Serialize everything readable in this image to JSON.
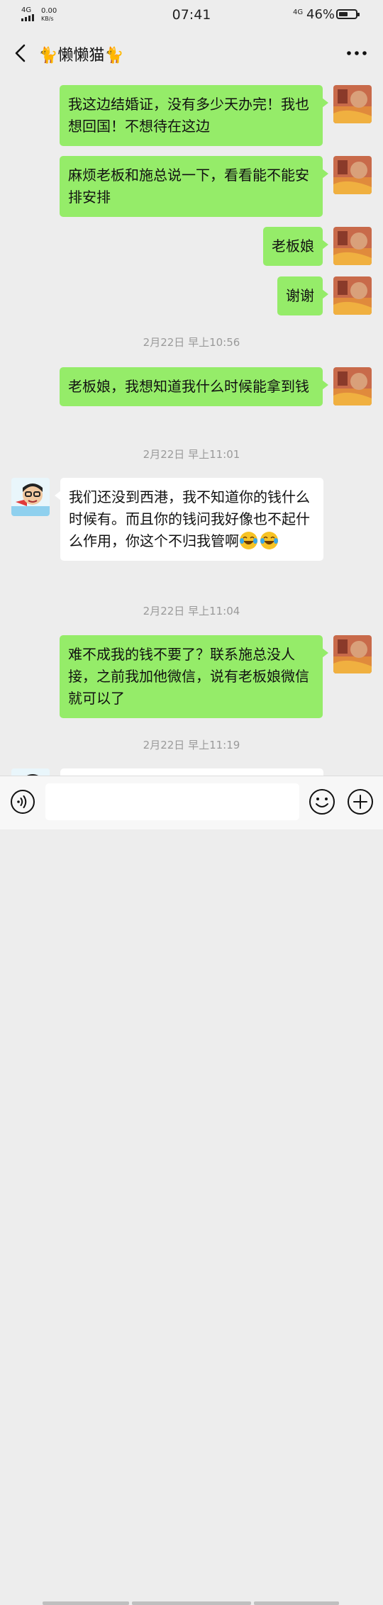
{
  "status_bar": {
    "network": "4G",
    "speed_value": "0.00",
    "speed_unit": "KB/s",
    "time": "07:41",
    "right_network": "4G",
    "battery": "46%"
  },
  "header": {
    "title": "🐈懒懒猫🐈"
  },
  "messages": [
    {
      "from": "me",
      "text": "我这边结婚证，没有多少天办完！我也想回国！不想待在这边"
    },
    {
      "from": "me",
      "text": "麻烦老板和施总说一下，看看能不能安排安排"
    },
    {
      "from": "me",
      "text": "老板娘"
    },
    {
      "from": "me",
      "text": "谢谢"
    },
    {
      "type": "time",
      "text": "2月22日 早上10:56"
    },
    {
      "from": "me",
      "text": "老板娘，我想知道我什么时候能拿到钱"
    },
    {
      "type": "time",
      "text": "2月22日 早上11:01"
    },
    {
      "from": "them",
      "text": "我们还没到西港，我不知道你的钱什么时候有。而且你的钱问我好像也不起什么作用，你这个不归我管啊"
    },
    {
      "type": "time",
      "text": "2月22日 早上11:04"
    },
    {
      "from": "me",
      "text": "难不成我的钱不要了？联系施总没人接，之前我加他微信，说有老板娘微信就可以了"
    },
    {
      "type": "time",
      "text": "2月22日 早上11:19"
    }
  ],
  "input": {
    "value": "",
    "placeholder": ""
  },
  "icons": {
    "back": "chevron-left-icon",
    "more": "more-dots-icon",
    "voice": "voice-icon",
    "emoji": "smiley-icon",
    "plus": "plus-circle-icon",
    "laugh_cry": "laughing-crying-emoji-icon"
  },
  "colors": {
    "background": "#ededed",
    "my_bubble": "#95ec69",
    "their_bubble": "#ffffff",
    "timestamp": "#9a9a9a"
  }
}
